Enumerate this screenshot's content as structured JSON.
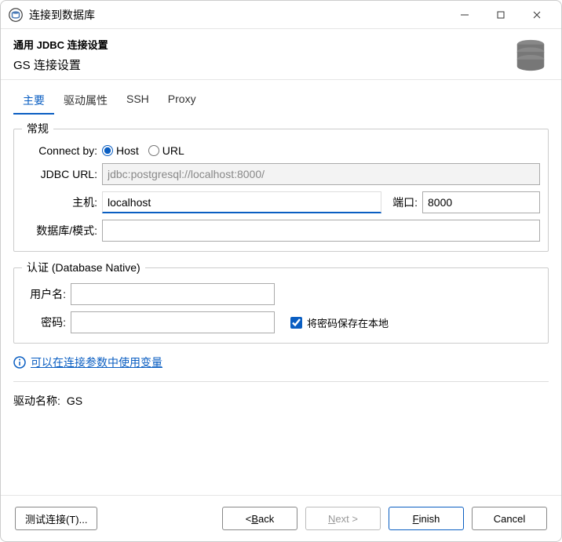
{
  "window": {
    "title": "连接到数据库"
  },
  "header": {
    "subtitle": "通用 JDBC 连接设置",
    "title": "GS 连接设置"
  },
  "tabs": [
    {
      "label": "主要",
      "active": true
    },
    {
      "label": "驱动属性",
      "active": false
    },
    {
      "label": "SSH",
      "active": false
    },
    {
      "label": "Proxy",
      "active": false
    }
  ],
  "general": {
    "legend": "常规",
    "connect_by_label": "Connect by:",
    "radio_host": "Host",
    "radio_url": "URL",
    "jdbc_label": "JDBC URL:",
    "jdbc_value": "jdbc:postgresql://localhost:8000/",
    "host_label": "主机:",
    "host_value": "localhost",
    "port_label": "端口:",
    "port_value": "8000",
    "db_label": "数据库/模式:",
    "db_value": ""
  },
  "auth": {
    "legend": "认证 (Database Native)",
    "user_label": "用户名:",
    "user_value": "",
    "pwd_label": "密码:",
    "pwd_value": "",
    "save_pwd_label": "将密码保存在本地"
  },
  "link": {
    "text": "可以在连接参数中使用变量"
  },
  "driver": {
    "label": "驱动名称:",
    "value": "GS"
  },
  "footer": {
    "test": "测试连接(T)...",
    "back_pre": "< ",
    "back_char": "B",
    "back_rest": "ack",
    "next_char": "N",
    "next_rest": "ext >",
    "finish_char": "F",
    "finish_rest": "inish",
    "cancel": "Cancel"
  }
}
